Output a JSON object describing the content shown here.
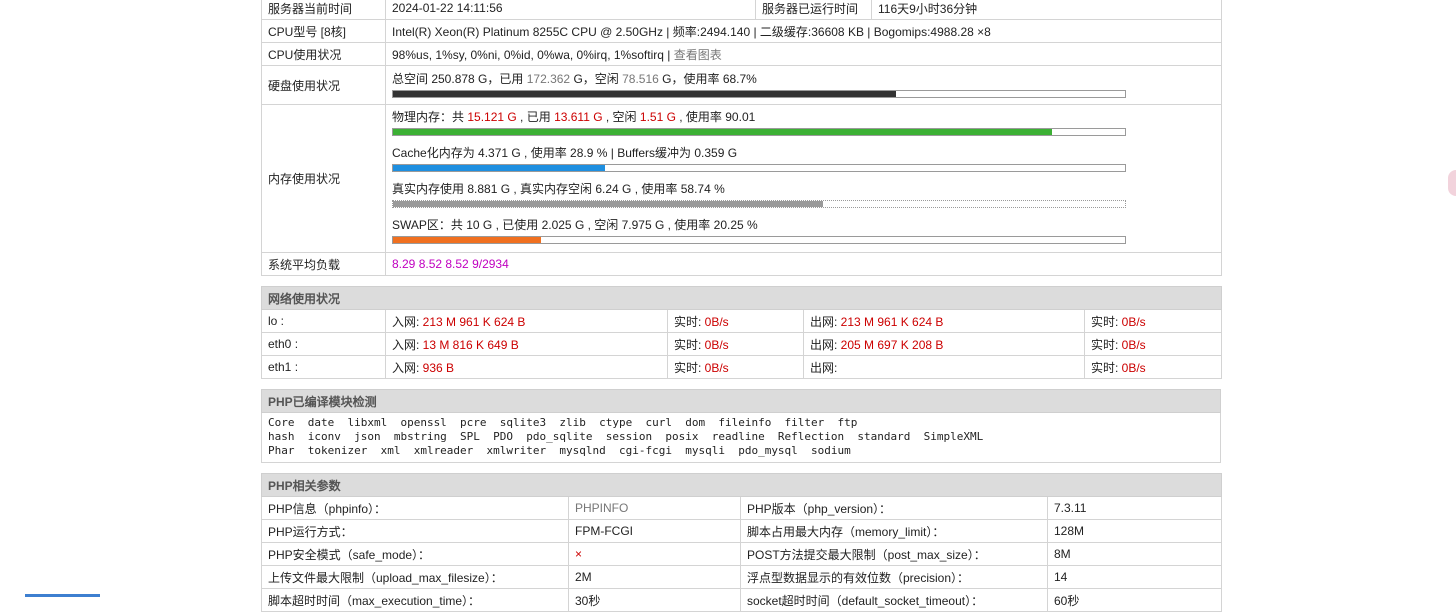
{
  "server": {
    "time_label": "服务器当前时间",
    "time_value": "2024-01-22 14:11:56",
    "uptime_label": "服务器已运行时间",
    "uptime_value": "116天9小时36分钟",
    "cpu_model_label": "CPU型号 [8核]",
    "cpu_model_value": "Intel(R) Xeon(R) Platinum 8255C CPU @ 2.50GHz | 频率:2494.140 | 二级缓存:36608 KB | Bogomips:4988.28 ×8",
    "cpu_usage_label": "CPU使用状况",
    "cpu_usage_value": "98%us, 1%sy, 0%ni, 0%id, 0%wa, 0%irq, 1%softirq",
    "cpu_usage_sep": " | ",
    "cpu_chart_link": "查看图表",
    "disk_label": "硬盘使用状况",
    "disk": {
      "prefix": "总空间 250.878 G，已用 ",
      "used": "172.362",
      "mid": " G，空闲 ",
      "free": "78.516",
      "suffix": " G，使用率 68.7%",
      "percent": 68.7,
      "color": "#333333"
    },
    "mem_label": "内存使用状况",
    "mem_physical": {
      "prefix": "物理内存：共 ",
      "total": "15.121 G",
      "mid1": " , 已用 ",
      "used": "13.611 G",
      "mid2": " , 空闲 ",
      "free": "1.51 G",
      "suffix": " , 使用率 90.01",
      "percent": 90.01,
      "color": "#3cb034"
    },
    "mem_cache": {
      "text": "Cache化内存为 4.371 G , 使用率 28.9 % | Buffers缓冲为 0.359 G",
      "percent": 28.9,
      "color": "#1e8fe0"
    },
    "mem_real": {
      "text": "真实内存使用 8.881 G , 真实内存空闲 6.24 G , 使用率 58.74 %",
      "percent": 58.74,
      "color": "#9a9a9a"
    },
    "mem_swap": {
      "text": "SWAP区：共 10 G , 已使用 2.025 G , 空闲 7.975 G , 使用率 20.25 %",
      "percent": 20.25,
      "color": "#f07020"
    },
    "load_label": "系统平均负载",
    "load_value": "8.29 8.52 8.52 9/2934"
  },
  "network": {
    "title": "网络使用状况",
    "in_label": "入网: ",
    "out_label": "出网: ",
    "rt_label": "实时: ",
    "rows": [
      {
        "iface": "lo :",
        "in": "213 M 961 K 624 B",
        "in_rt": "0B/s",
        "out": "213 M 961 K 624 B",
        "out_rt": "0B/s"
      },
      {
        "iface": "eth0 :",
        "in": "13 M 816 K 649 B",
        "in_rt": "0B/s",
        "out": "205 M 697 K 208 B",
        "out_rt": "0B/s"
      },
      {
        "iface": "eth1 :",
        "in": "936 B",
        "in_rt": "0B/s",
        "out": "",
        "out_rt": "0B/s"
      }
    ]
  },
  "php_modules": {
    "title": "PHP已编译模块检测",
    "line1": "Core  date  libxml  openssl  pcre  sqlite3  zlib  ctype  curl  dom  fileinfo  filter  ftp",
    "line2": "hash  iconv  json  mbstring  SPL  PDO  pdo_sqlite  session  posix  readline  Reflection  standard  SimpleXML",
    "line3": "Phar  tokenizer  xml  xmlreader  xmlwriter  mysqlnd  cgi-fcgi  mysqli  pdo_mysql  sodium"
  },
  "php_params": {
    "title": "PHP相关参数",
    "rows": [
      {
        "l1": "PHP信息（phpinfo）：",
        "v1": "PHPINFO",
        "l2": "PHP版本（php_version）：",
        "v2": "7.3.11"
      },
      {
        "l1": "PHP运行方式：",
        "v1": "FPM-FCGI",
        "l2": "脚本占用最大内存（memory_limit）：",
        "v2": "128M"
      },
      {
        "l1": "PHP安全模式（safe_mode）：",
        "v1": "×",
        "l2": "POST方法提交最大限制（post_max_size）：",
        "v2": "8M"
      },
      {
        "l1": "上传文件最大限制（upload_max_filesize）：",
        "v1": "2M",
        "l2": "浮点型数据显示的有效位数（precision）：",
        "v2": "14"
      },
      {
        "l1": "脚本超时时间（max_execution_time）：",
        "v1": "30秒",
        "l2": "socket超时时间（default_socket_timeout）：",
        "v2": "60秒"
      }
    ]
  }
}
